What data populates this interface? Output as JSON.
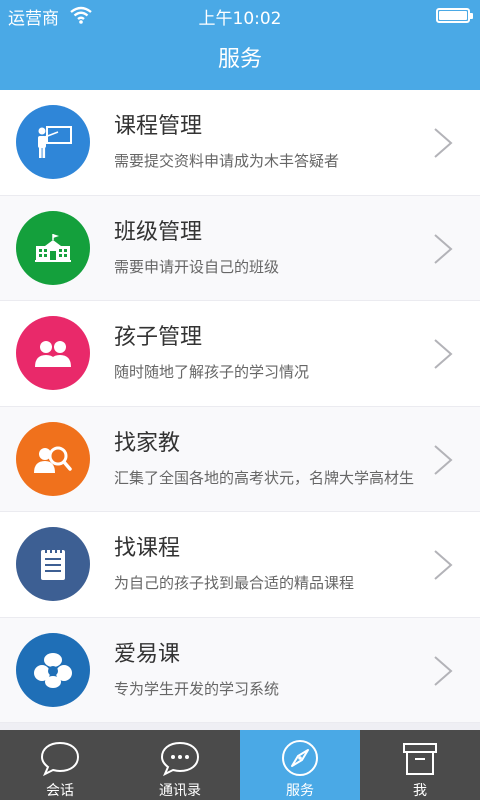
{
  "status_bar": {
    "carrier": "运营商",
    "time": "上午10:02"
  },
  "nav": {
    "title": "服务"
  },
  "items": [
    {
      "title": "课程管理",
      "subtitle": "需要提交资料申请成为木丰答疑者",
      "icon": "teacher-board-icon",
      "color": "#2f86d8"
    },
    {
      "title": "班级管理",
      "subtitle": "需要申请开设自己的班级",
      "icon": "school-building-icon",
      "color": "#14a03c"
    },
    {
      "title": "孩子管理",
      "subtitle": "随时随地了解孩子的学习情况",
      "icon": "children-icon",
      "color": "#e9296a"
    },
    {
      "title": "找家教",
      "subtitle": "汇集了全国各地的高考状元，名牌大学高材生",
      "icon": "tutor-search-icon",
      "color": "#f0711c"
    },
    {
      "title": "找课程",
      "subtitle": "为自己的孩子找到最合适的精品课程",
      "icon": "notebook-icon",
      "color": "#3d5f93"
    },
    {
      "title": "爱易课",
      "subtitle": "专为学生开发的学习系统",
      "icon": "clover-logo-icon",
      "color": "#1f6fb7"
    }
  ],
  "tabs": [
    {
      "label": "会话",
      "icon": "chat-bubble-icon",
      "active": false
    },
    {
      "label": "通讯录",
      "icon": "contacts-bubble-icon",
      "active": false
    },
    {
      "label": "服务",
      "icon": "compass-icon",
      "active": true
    },
    {
      "label": "我",
      "icon": "archive-box-icon",
      "active": false
    }
  ]
}
